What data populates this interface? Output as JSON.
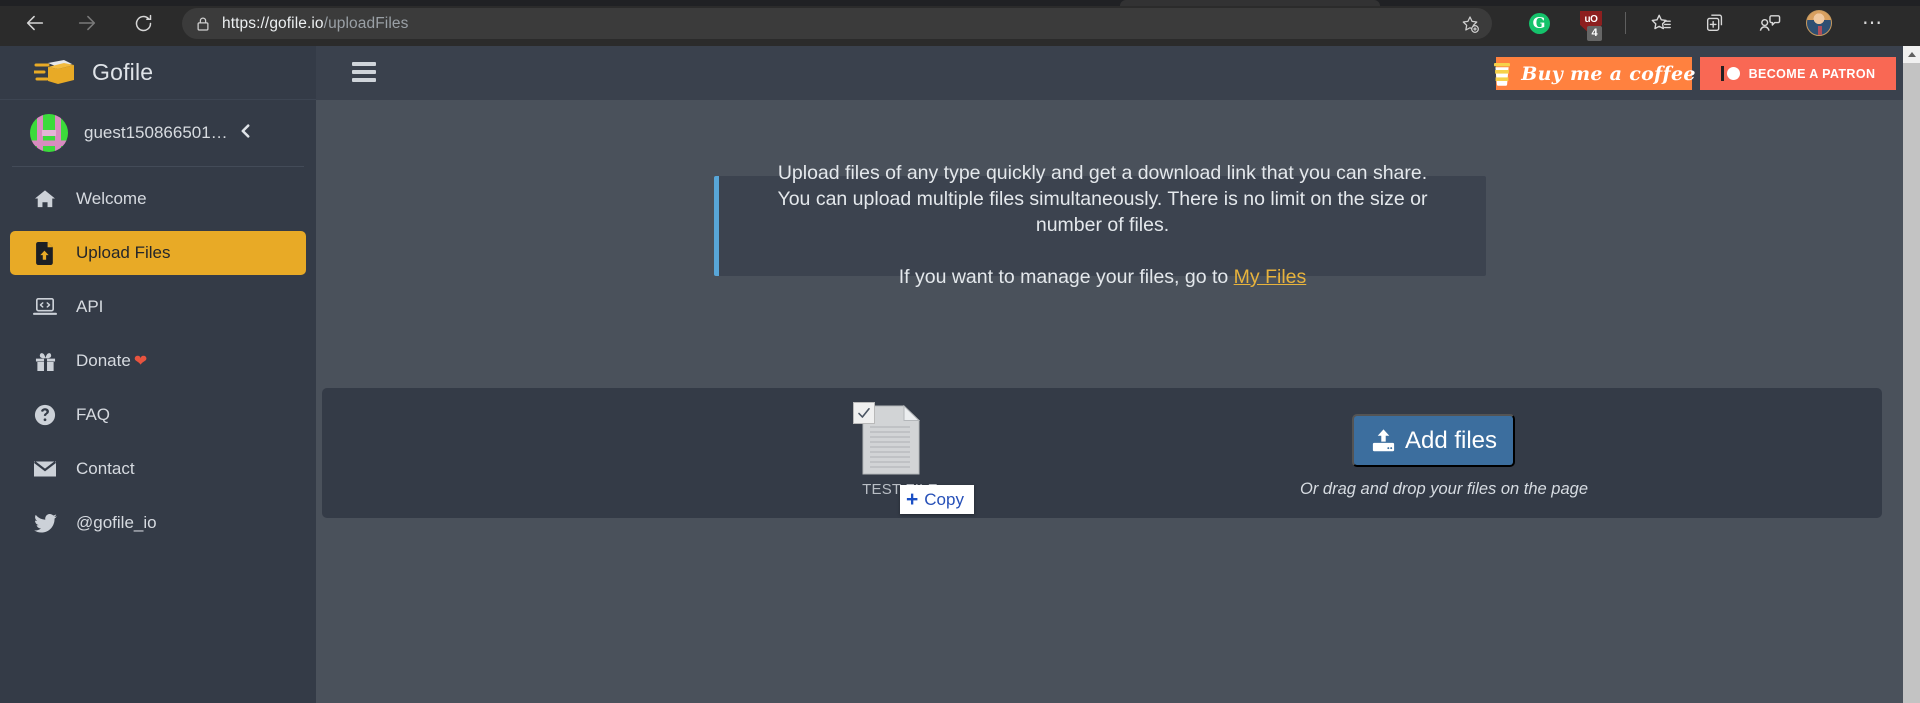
{
  "browser": {
    "back_icon": "back-arrow-icon",
    "forward_icon": "forward-arrow-icon",
    "reload_icon": "reload-icon",
    "lock_icon": "lock-icon",
    "url_scheme": "https://",
    "url_host": "gofile.io",
    "url_path": "/uploadFiles",
    "url_full": "https://gofile.io/uploadFiles",
    "bookmark_icon": "bookmark-star-icon",
    "extensions": [
      {
        "name": "grammarly-extension-icon",
        "letter": "G",
        "color": "#15c26b"
      },
      {
        "name": "ublock-origin-extension-icon",
        "letter": "uO",
        "badge": "4",
        "color": "#8d1f1f"
      }
    ],
    "toolbar_icons": [
      "favorites-icon",
      "collections-icon",
      "browser-essentials-icon",
      "profile-avatar",
      "settings-and-more-icon"
    ]
  },
  "sidebar": {
    "brand": {
      "logo_icon": "gofile-folder-logo",
      "name": "Gofile"
    },
    "user": {
      "avatar_icon": "user-identicon-avatar",
      "name": "guest150866501…",
      "collapse_icon": "chevron-left-icon"
    },
    "items": [
      {
        "label": "Welcome",
        "icon": "home-icon",
        "active": false
      },
      {
        "label": "Upload Files",
        "icon": "file-upload-icon",
        "active": true
      },
      {
        "label": "API",
        "icon": "laptop-code-icon",
        "active": false
      },
      {
        "label": "Donate",
        "icon": "gift-icon",
        "active": false,
        "suffix": "❤"
      },
      {
        "label": "FAQ",
        "icon": "question-circle-icon",
        "active": false
      },
      {
        "label": "Contact",
        "icon": "envelope-icon",
        "active": false
      },
      {
        "label": "@gofile_io",
        "icon": "twitter-icon",
        "active": false
      }
    ]
  },
  "topbar": {
    "menu_icon": "hamburger-menu-icon",
    "coffee_button": {
      "label": "Buy me a coffee",
      "icon": "coffee-cup-icon",
      "color": "#ff813f"
    },
    "patron_button": {
      "label": "BECOME A PATRON",
      "icon": "patreon-icon",
      "color": "#f96854"
    }
  },
  "main": {
    "info": {
      "line1": "Upload files of any type quickly and get a download link that you can share.",
      "line2": "You can upload multiple files simultaneously. There is no limit on the size or number of files.",
      "line3_prefix": "If you want to manage your files, go to ",
      "link_label": "My Files",
      "accent_color": "#58a6d8",
      "link_color": "#e8b33c"
    },
    "upload": {
      "add_files_label": "Add files",
      "add_files_icon": "file-upload-icon",
      "add_files_color": "#3c6e9e",
      "drag_hint": "Or drag and drop your files on the page"
    },
    "drag_ghost": {
      "file_name": "TEST FILE",
      "file_icon": "document-file-icon",
      "check_icon": "checkmark-icon",
      "tooltip_plus": "+",
      "tooltip_label": "Copy"
    }
  },
  "scrollbar": {
    "up_arrow_icon": "scroll-up-arrow-icon"
  }
}
